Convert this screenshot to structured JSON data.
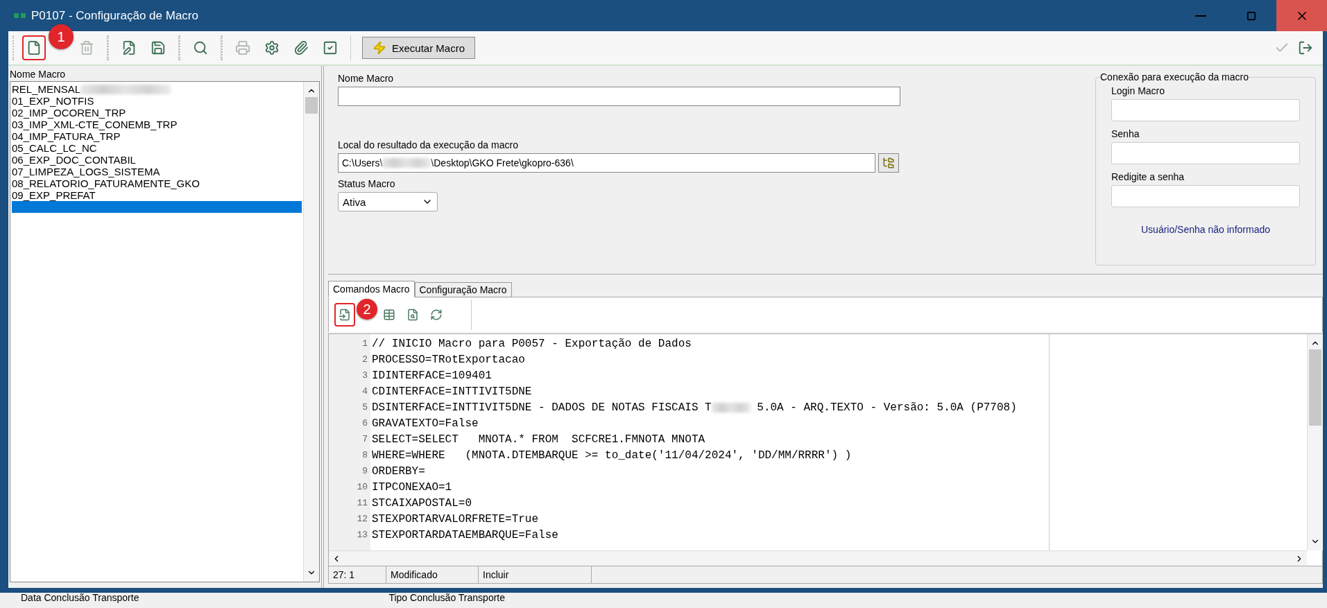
{
  "window": {
    "title": "P0107 - Configuração de Macro"
  },
  "toolbar": {
    "groups": [
      [
        {
          "kind": "new",
          "disabled": false,
          "callout": "1"
        },
        {
          "kind": "delete",
          "disabled": true
        }
      ],
      [
        {
          "kind": "edit",
          "disabled": false
        },
        {
          "kind": "save",
          "disabled": false
        }
      ],
      [
        {
          "kind": "find",
          "disabled": false
        }
      ],
      [
        {
          "kind": "print",
          "disabled": true
        },
        {
          "kind": "settings",
          "disabled": false
        },
        {
          "kind": "attach",
          "disabled": false
        },
        {
          "kind": "confirm",
          "disabled": false
        }
      ]
    ],
    "run_button": "Executar Macro",
    "right_buttons": [
      {
        "kind": "check",
        "disabled": true
      },
      {
        "kind": "exit",
        "disabled": false
      }
    ]
  },
  "macro_list": {
    "header": "Nome Macro",
    "items": [
      {
        "label": "REL_MENSAL",
        "blurred_tail": true,
        "selected": false
      },
      {
        "label": "01_EXP_NOTFIS",
        "selected": false
      },
      {
        "label": "02_IMP_OCOREN_TRP",
        "selected": false
      },
      {
        "label": "03_IMP_XML-CTE_CONEMB_TRP",
        "selected": false
      },
      {
        "label": "04_IMP_FATURA_TRP",
        "selected": false
      },
      {
        "label": "05_CALC_LC_NC",
        "selected": false
      },
      {
        "label": "06_EXP_DOC_CONTABIL",
        "selected": false
      },
      {
        "label": "07_LIMPEZA_LOGS_SISTEMA",
        "selected": false
      },
      {
        "label": "08_RELATORIO_FATURAMENTE_GKO",
        "selected": false
      },
      {
        "label": "09_EXP_PREFAT",
        "selected": false
      },
      {
        "selected": true
      }
    ]
  },
  "form": {
    "name_label": "Nome Macro",
    "result_label": "Local do resultado da execução da macro",
    "result_path_start": "C:\\Users\\",
    "result_path_end": "\\Desktop\\GKO Frete\\gkopro-636\\",
    "status_label": "Status Macro",
    "status_value": "Ativa"
  },
  "connection": {
    "title": "Conexão para execução da macro",
    "fields": [
      {
        "label": "Login Macro"
      },
      {
        "label": "Senha"
      },
      {
        "label": "Redigite a senha"
      }
    ],
    "message": "Usuário/Senha não informado"
  },
  "tabs": [
    {
      "label": "Comandos Macro",
      "selected": true
    },
    {
      "label": "Configuração Macro",
      "selected": false
    }
  ],
  "editor_tools": [
    {
      "kind": "import",
      "callout": "2"
    },
    {
      "kind": "table"
    },
    {
      "kind": "search"
    },
    {
      "kind": "refresh"
    }
  ],
  "code_lines": [
    {
      "number": "1",
      "text": "// INICIO Macro para P0057 - Exportação de Dados"
    },
    {
      "number": "2",
      "text": "PROCESSO=TRotExportacao"
    },
    {
      "number": "3",
      "text": "IDINTERFACE=109401"
    },
    {
      "number": "4",
      "text": "CDINTERFACE=INTTIVIT5DNE"
    },
    {
      "number": "5",
      "text": "DSINTERFACE=INTTIVIT5DNE - DADOS DE NOTAS FISCAIS T",
      "text_after_blur": " 5.0A - ARQ.TEXTO - Versão: 5.0A (P7708)"
    },
    {
      "number": "6",
      "text": "GRAVATEXTO=False"
    },
    {
      "number": "7",
      "text": "SELECT=SELECT   MNOTA.* FROM  SCFCRE1.FMNOTA MNOTA"
    },
    {
      "number": "8",
      "text": "WHERE=WHERE   (MNOTA.DTEMBARQUE >= to_date('11/04/2024', 'DD/MM/RRRR') )"
    },
    {
      "number": "9",
      "text": "ORDERBY="
    },
    {
      "number": "10",
      "text": "ITPCONEXAO=1"
    },
    {
      "number": "11",
      "text": "STCAIXAPOSTAL=0"
    },
    {
      "number": "12",
      "text": "STEXPORTARVALORFRETE=True"
    },
    {
      "number": "13",
      "text": "STEXPORTARDATAEMBARQUE=False"
    }
  ],
  "status_bar": [
    "27: 1",
    "Modificado",
    "Incluir"
  ],
  "background_labels": [
    "Data Conclusão Transporte",
    "Tipo Conclusão Transporte"
  ]
}
